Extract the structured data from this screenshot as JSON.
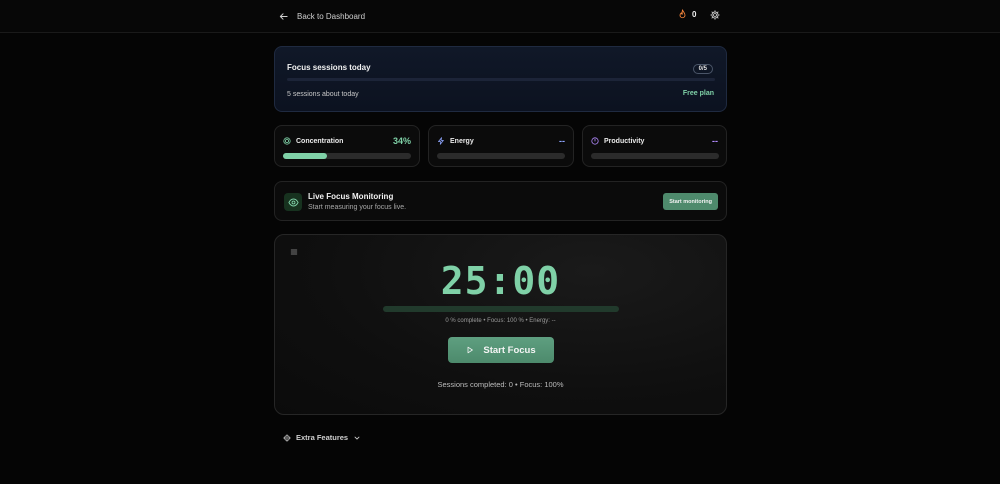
{
  "topbar": {
    "back_label": "Back to Dashboard",
    "streak_count": "0",
    "icons": [
      "arrow-left-icon",
      "flame-icon",
      "gear-icon"
    ]
  },
  "sessions": {
    "title": "Focus sessions today",
    "badge": "0/5",
    "progress": 0,
    "subtitle": "5 sessions about today",
    "plan": "Free plan"
  },
  "metrics": [
    {
      "label": "Concentration",
      "value": "34%",
      "fill": 0.34,
      "color": "#7fd1a7",
      "icon": "target-icon"
    },
    {
      "label": "Energy",
      "value": "--",
      "fill": 0,
      "color": "#8fa6ff",
      "icon": "zap-icon"
    },
    {
      "label": "Productivity",
      "value": "--",
      "fill": 0,
      "color": "#b38bff",
      "icon": "timer-icon"
    }
  ],
  "live": {
    "title": "Live Focus Monitoring",
    "subtitle": "Start measuring your focus live.",
    "button": "Start monitoring",
    "icon": "eye-icon"
  },
  "timer": {
    "time": "25:00",
    "progress": 0,
    "status": "0 % complete • Focus: 100 % • Energy: --",
    "start_label": "Start Focus",
    "footer": "Sessions completed: 0 • Focus: 100%"
  },
  "extra": {
    "label": "Extra Features",
    "icons": [
      "gear-icon",
      "chevron-down-icon"
    ]
  },
  "colors": {
    "accent": "#7fd1a7",
    "button": "#4e8a6c",
    "background": "#050505"
  }
}
